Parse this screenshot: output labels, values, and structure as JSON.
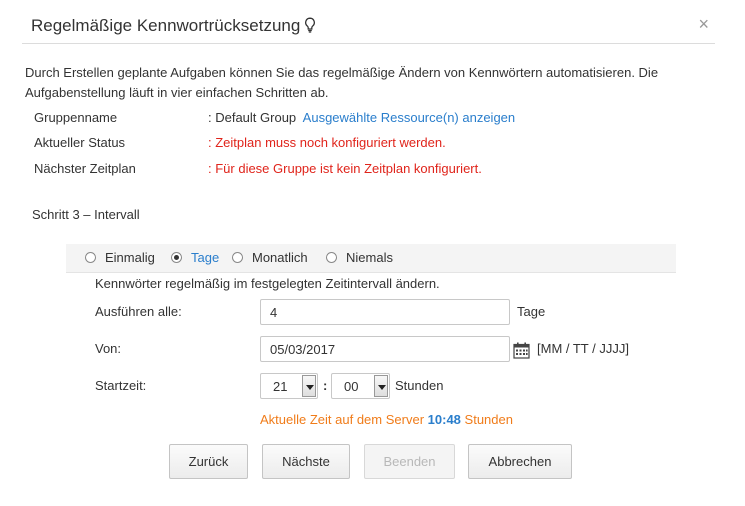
{
  "dialog": {
    "title": "Regelmäßige Kennwortrücksetzung",
    "title_icon": "lightbulb-icon",
    "close_label": "×",
    "intro": "Durch Erstellen geplante Aufgaben können Sie das regelmäßige Ändern von Kennwörtern automatisieren. Die Aufgabenstellung läuft in vier einfachen Schritten ab."
  },
  "info": {
    "group_label": "Gruppenname",
    "group_value": ": Default Group",
    "group_link": "Ausgewählte Ressource(n) anzeigen",
    "status_label": "Aktueller Status",
    "status_value": ": Zeitplan muss noch konfiguriert werden.",
    "schedule_label": "Nächster Zeitplan",
    "schedule_value": ": Für diese Gruppe ist kein Zeitplan konfiguriert."
  },
  "step": {
    "title": "Schritt 3 – Intervall",
    "options": [
      "Einmalig",
      "Tage",
      "Monatlich",
      "Niemals"
    ],
    "selected_option": "Tage",
    "description": "Kennwörter regelmäßig im festgelegten Zeitintervall ändern.",
    "run_every_label": "Ausführen alle:",
    "run_every_value": "4",
    "run_every_unit": "Tage",
    "from_label": "Von:",
    "from_value": "05/03/2017",
    "date_format": "[MM / TT / JJJJ]",
    "start_label": "Startzeit:",
    "hour_value": "21",
    "minute_value": "00",
    "time_separator": ":",
    "time_unit": "Stunden",
    "server_time_prefix": "Aktuelle Zeit auf dem Server",
    "server_time_value": "10:48",
    "server_time_suffix": "Stunden"
  },
  "buttons": {
    "back": "Zurück",
    "next": "Nächste",
    "finish": "Beenden",
    "cancel": "Abbrechen"
  },
  "colors": {
    "accent": "#2a7ecc",
    "error": "#e0241b",
    "info_orange": "#f07c1a"
  }
}
